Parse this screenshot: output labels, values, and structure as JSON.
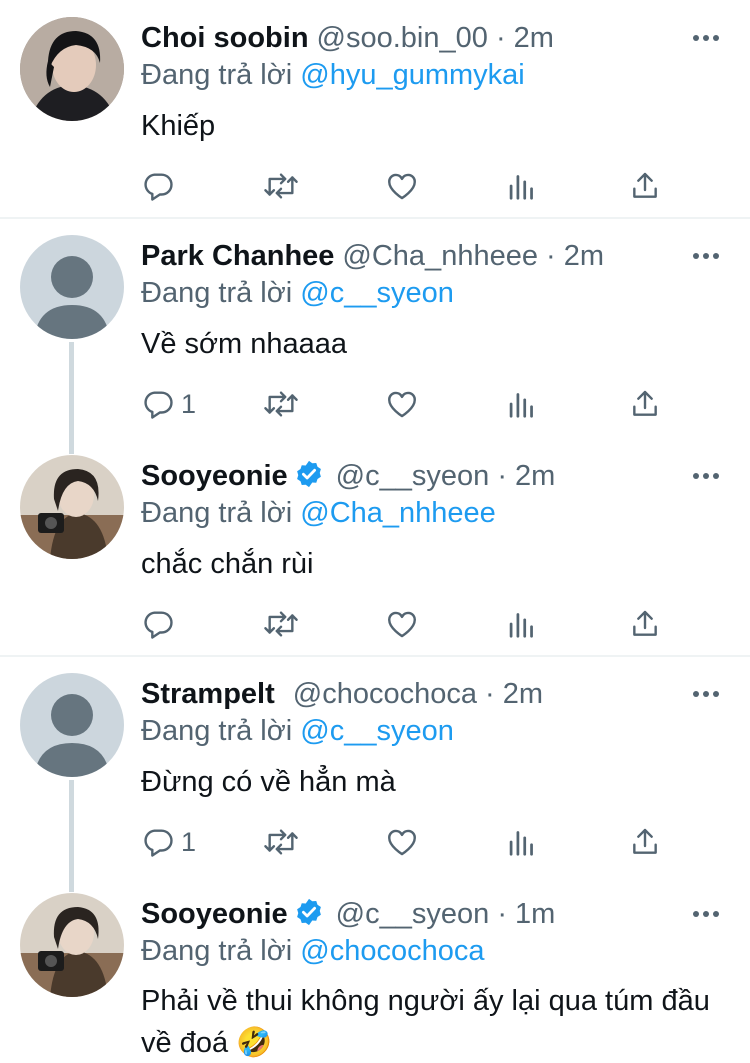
{
  "colors": {
    "accent": "#1d9bf0",
    "secondary_text": "#536471",
    "primary_text": "#0f1419"
  },
  "tweets": [
    {
      "name": "Choi soobin",
      "verified": false,
      "handle": "@soo.bin_00",
      "dot": "·",
      "time": "2m",
      "replying_prefix": "Đang trả lời",
      "replying_to": "@hyu_gummykai",
      "text": "Khiếp",
      "reply_count": "",
      "avatar": "photo-dark-hair"
    },
    {
      "name": "Park Chanhee",
      "verified": false,
      "handle": "@Cha_nhheee",
      "dot": "·",
      "time": "2m",
      "replying_prefix": "Đang trả lời",
      "replying_to": "@c__syeon",
      "text": "Về sớm nhaaaa",
      "reply_count": "1",
      "avatar": "default-avatar"
    },
    {
      "name": "Sooyeonie",
      "verified": true,
      "handle": "@c__syeon",
      "dot": "·",
      "time": "2m",
      "replying_prefix": "Đang trả lời",
      "replying_to": "@Cha_nhheee",
      "text": "chắc chắn rùi",
      "reply_count": "",
      "avatar": "photo-girl-camera"
    },
    {
      "name": "Strampelt",
      "verified": false,
      "handle": "@chocochoca",
      "dot": "·",
      "time": "2m",
      "replying_prefix": "Đang trả lời",
      "replying_to": "@c__syeon",
      "text": "Đừng có về hẳn mà",
      "reply_count": "1",
      "avatar": "default-avatar"
    },
    {
      "name": "Sooyeonie",
      "verified": true,
      "handle": "@c__syeon",
      "dot": "·",
      "time": "1m",
      "replying_prefix": "Đang trả lời",
      "replying_to": "@chocochoca",
      "text": "Phải về thui không người ấy lại qua túm đầu về đoá 🤣",
      "reply_count": "",
      "avatar": "photo-girl-camera"
    }
  ]
}
